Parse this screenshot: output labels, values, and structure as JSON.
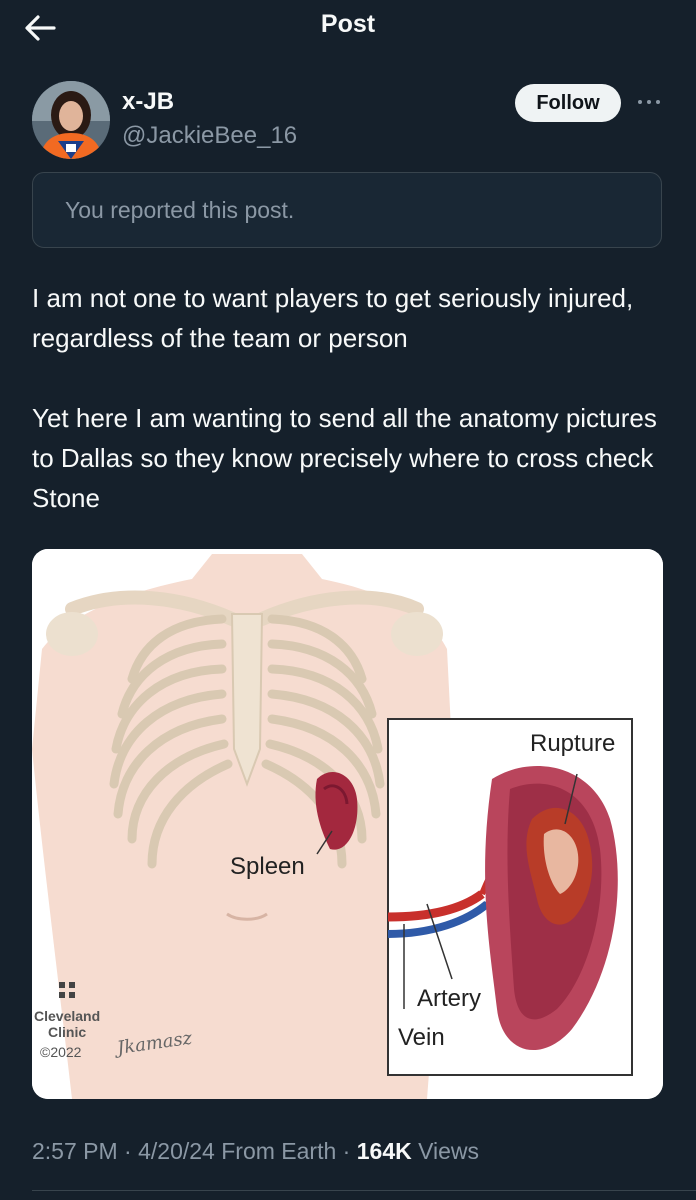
{
  "header": {
    "title": "Post",
    "back_icon": "arrow-left-icon"
  },
  "author": {
    "name": "x-JB",
    "handle": "@JackieBee_16",
    "follow_label": "Follow",
    "more_icon": "more-horizontal-icon"
  },
  "notice": {
    "text": "You reported this post."
  },
  "post": {
    "paragraph_1": "I am not one to want players to get seriously injured, regardless of the team or person",
    "paragraph_2": "Yet here I am wanting to send all the anatomy pictures to Dallas so they know precisely where to cross check Stone"
  },
  "media": {
    "label_spleen": "Spleen",
    "label_rupture": "Rupture",
    "label_artery": "Artery",
    "label_vein": "Vein",
    "logo_line1": "Cleveland",
    "logo_line2": "Clinic",
    "logo_line3": "©2022",
    "signature": "Jkamasz"
  },
  "meta": {
    "time": "2:57 PM",
    "date": "4/20/24",
    "source": "From Earth",
    "views_count": "164K",
    "views_label": "Views",
    "separator": "·"
  },
  "colors": {
    "background": "#15202b",
    "text_primary": "#f7f9f9",
    "text_secondary": "#8b98a5",
    "border": "#38444d"
  }
}
